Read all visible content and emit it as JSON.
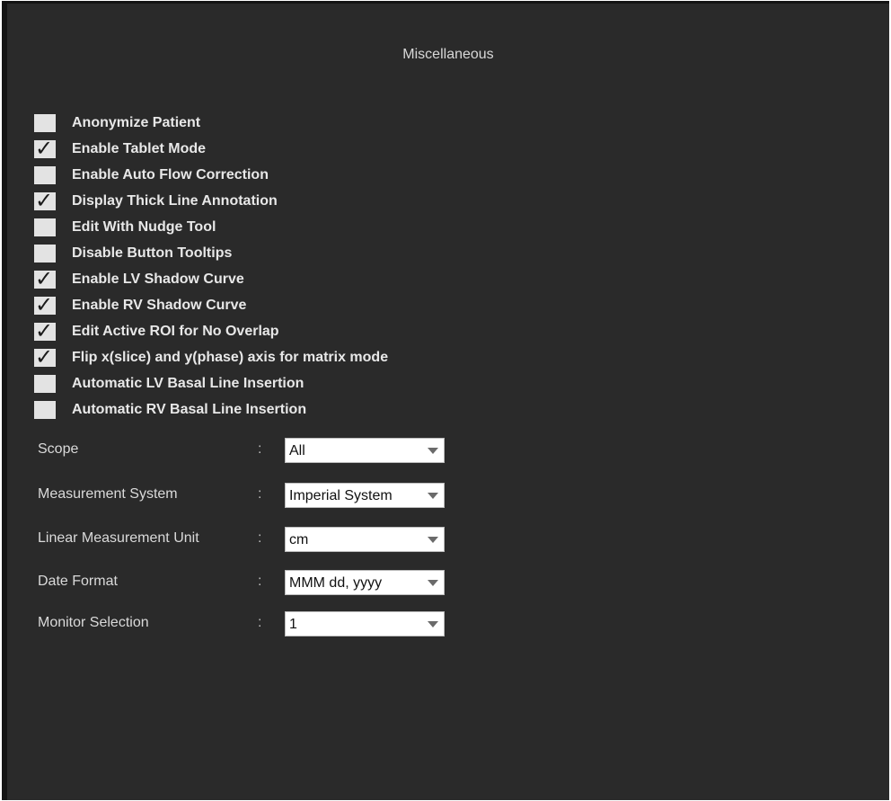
{
  "panel": {
    "title": "Miscellaneous"
  },
  "checkboxes": [
    {
      "label": "Anonymize Patient",
      "checked": false
    },
    {
      "label": "Enable Tablet Mode",
      "checked": true
    },
    {
      "label": "Enable Auto Flow Correction",
      "checked": false
    },
    {
      "label": "Display Thick Line Annotation",
      "checked": true
    },
    {
      "label": "Edit With Nudge Tool",
      "checked": false
    },
    {
      "label": "Disable Button Tooltips",
      "checked": false
    },
    {
      "label": "Enable LV Shadow Curve",
      "checked": true
    },
    {
      "label": "Enable RV Shadow Curve",
      "checked": true
    },
    {
      "label": "Edit Active ROI for No Overlap",
      "checked": true
    },
    {
      "label": "Flip x(slice) and y(phase) axis for matrix mode",
      "checked": true
    },
    {
      "label": "Automatic LV Basal Line Insertion",
      "checked": false
    },
    {
      "label": "Automatic RV Basal Line Insertion",
      "checked": false
    }
  ],
  "check_glyph": "✓",
  "separator": ":",
  "settings": [
    {
      "label": "Scope",
      "value": "All"
    },
    {
      "label": "Measurement System",
      "value": "Imperial System"
    },
    {
      "label": "Linear Measurement Unit",
      "value": "cm"
    },
    {
      "label": "Date Format",
      "value": "MMM dd, yyyy"
    },
    {
      "label": "Monitor Selection",
      "value": "1"
    }
  ]
}
